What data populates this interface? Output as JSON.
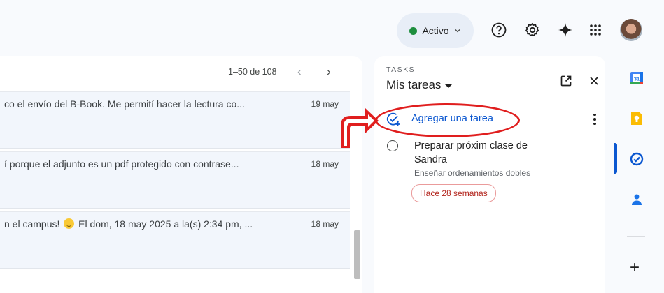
{
  "header": {
    "status_label": "Activo",
    "icons": [
      "help-icon",
      "gear-icon",
      "sparkle-icon",
      "apps-grid-icon"
    ]
  },
  "mail": {
    "pagination": "1–50 de 108",
    "rows": [
      {
        "snippet": "co el envío del B-Book. Me permití hacer la lectura co...",
        "date": "19 may"
      },
      {
        "snippet": "í porque el adjunto es un pdf protegido con contrase...",
        "date": "18 may"
      },
      {
        "snippet_before": "n el campus! ",
        "snippet_after": " El dom, 18 may 2025 a la(s) 2:34 pm, ...",
        "date": "18 may"
      }
    ]
  },
  "tasks": {
    "section_label": "TASKS",
    "list_title": "Mis tareas",
    "add_task_label": "Agregar una tarea",
    "items": [
      {
        "title": "Preparar próxim clase de Sandra",
        "note": "Enseñar ordenamientos dobles",
        "due_chip": "Hace 28 semanas"
      }
    ]
  },
  "side_rail": {
    "apps": [
      "calendar-icon",
      "keep-icon",
      "tasks-icon",
      "contacts-icon"
    ],
    "calendar_day": "31"
  },
  "colors": {
    "accent": "#0b57d0",
    "status_green": "#1e8e3e",
    "annotation_red": "#e01e1e",
    "overdue_red": "#b3261e"
  }
}
